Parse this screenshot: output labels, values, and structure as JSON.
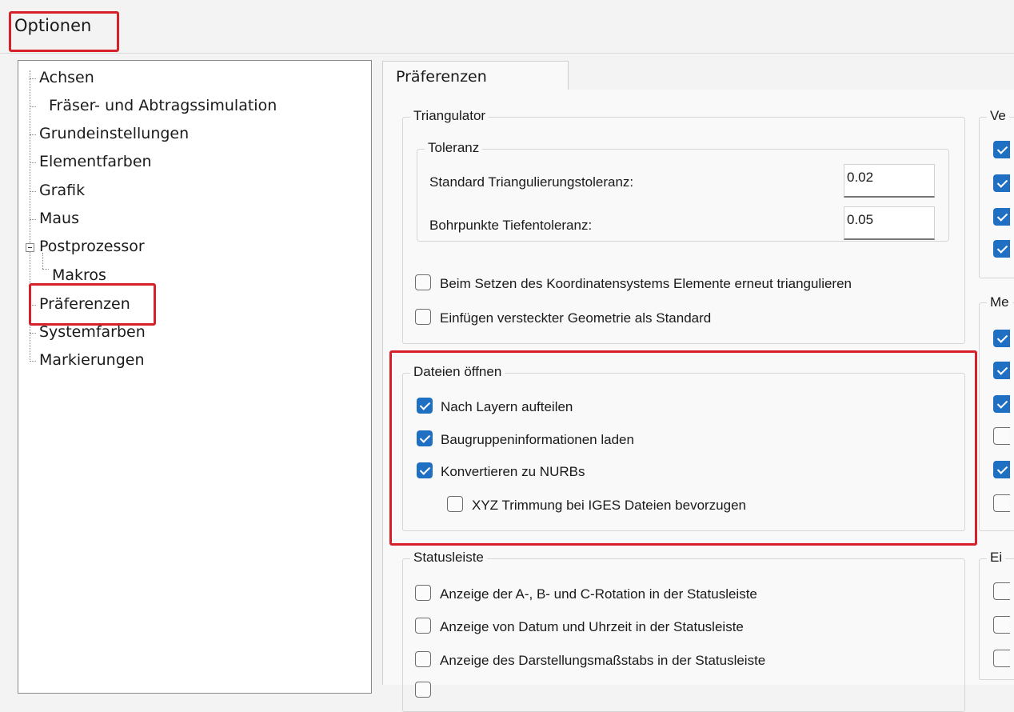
{
  "window": {
    "title": "Optionen"
  },
  "tree": {
    "items": [
      {
        "label": "Achsen"
      },
      {
        "label": "Fräser- und Abtragssimulation"
      },
      {
        "label": "Grundeinstellungen"
      },
      {
        "label": "Elementfarben"
      },
      {
        "label": "Grafik"
      },
      {
        "label": "Maus"
      },
      {
        "label": "Postprozessor",
        "expanded": true
      },
      {
        "label": "Makros"
      },
      {
        "label": "Präferenzen",
        "selected": true
      },
      {
        "label": "Systemfarben"
      },
      {
        "label": "Markierungen"
      }
    ]
  },
  "tabs": [
    {
      "label": "Präferenzen",
      "active": true
    }
  ],
  "triangulator": {
    "title": "Triangulator",
    "toleranz": {
      "title": "Toleranz",
      "standard_label": "Standard Triangulierungstoleranz:",
      "standard_value": "0.02",
      "bohr_label": "Bohrpunkte Tiefentoleranz:",
      "bohr_value": "0.05"
    },
    "options": [
      {
        "label": "Beim Setzen des Koordinatensystems Elemente erneut triangulieren",
        "checked": false
      },
      {
        "label": "Einfügen versteckter Geometrie als Standard",
        "checked": false
      }
    ]
  },
  "dateien": {
    "title": "Dateien öffnen",
    "options": [
      {
        "label": "Nach Layern aufteilen",
        "checked": true
      },
      {
        "label": "Baugruppeninformationen laden",
        "checked": true
      },
      {
        "label": "Konvertieren zu NURBs",
        "checked": true
      },
      {
        "label": "XYZ Trimmung bei IGES Dateien bevorzugen",
        "checked": false
      }
    ]
  },
  "statusleiste": {
    "title": "Statusleiste",
    "options": [
      {
        "label": "Anzeige der A-, B- und C-Rotation in der Statusleiste",
        "checked": false
      },
      {
        "label": "Anzeige von Datum und Uhrzeit in der Statusleiste",
        "checked": false
      },
      {
        "label": "Anzeige des Darstellungsmaßstabs in der Statusleiste",
        "checked": false
      }
    ]
  },
  "right_groups": {
    "ve": {
      "title": "Ve",
      "checks": [
        true,
        true,
        true,
        true
      ]
    },
    "me": {
      "title": "Me",
      "checks": [
        true,
        true,
        true,
        false,
        true,
        false
      ]
    },
    "ei": {
      "title": "Ei",
      "checks": [
        false,
        false,
        false
      ]
    }
  },
  "colors": {
    "highlight": "#d6202a",
    "accent": "#1f6fc2"
  }
}
